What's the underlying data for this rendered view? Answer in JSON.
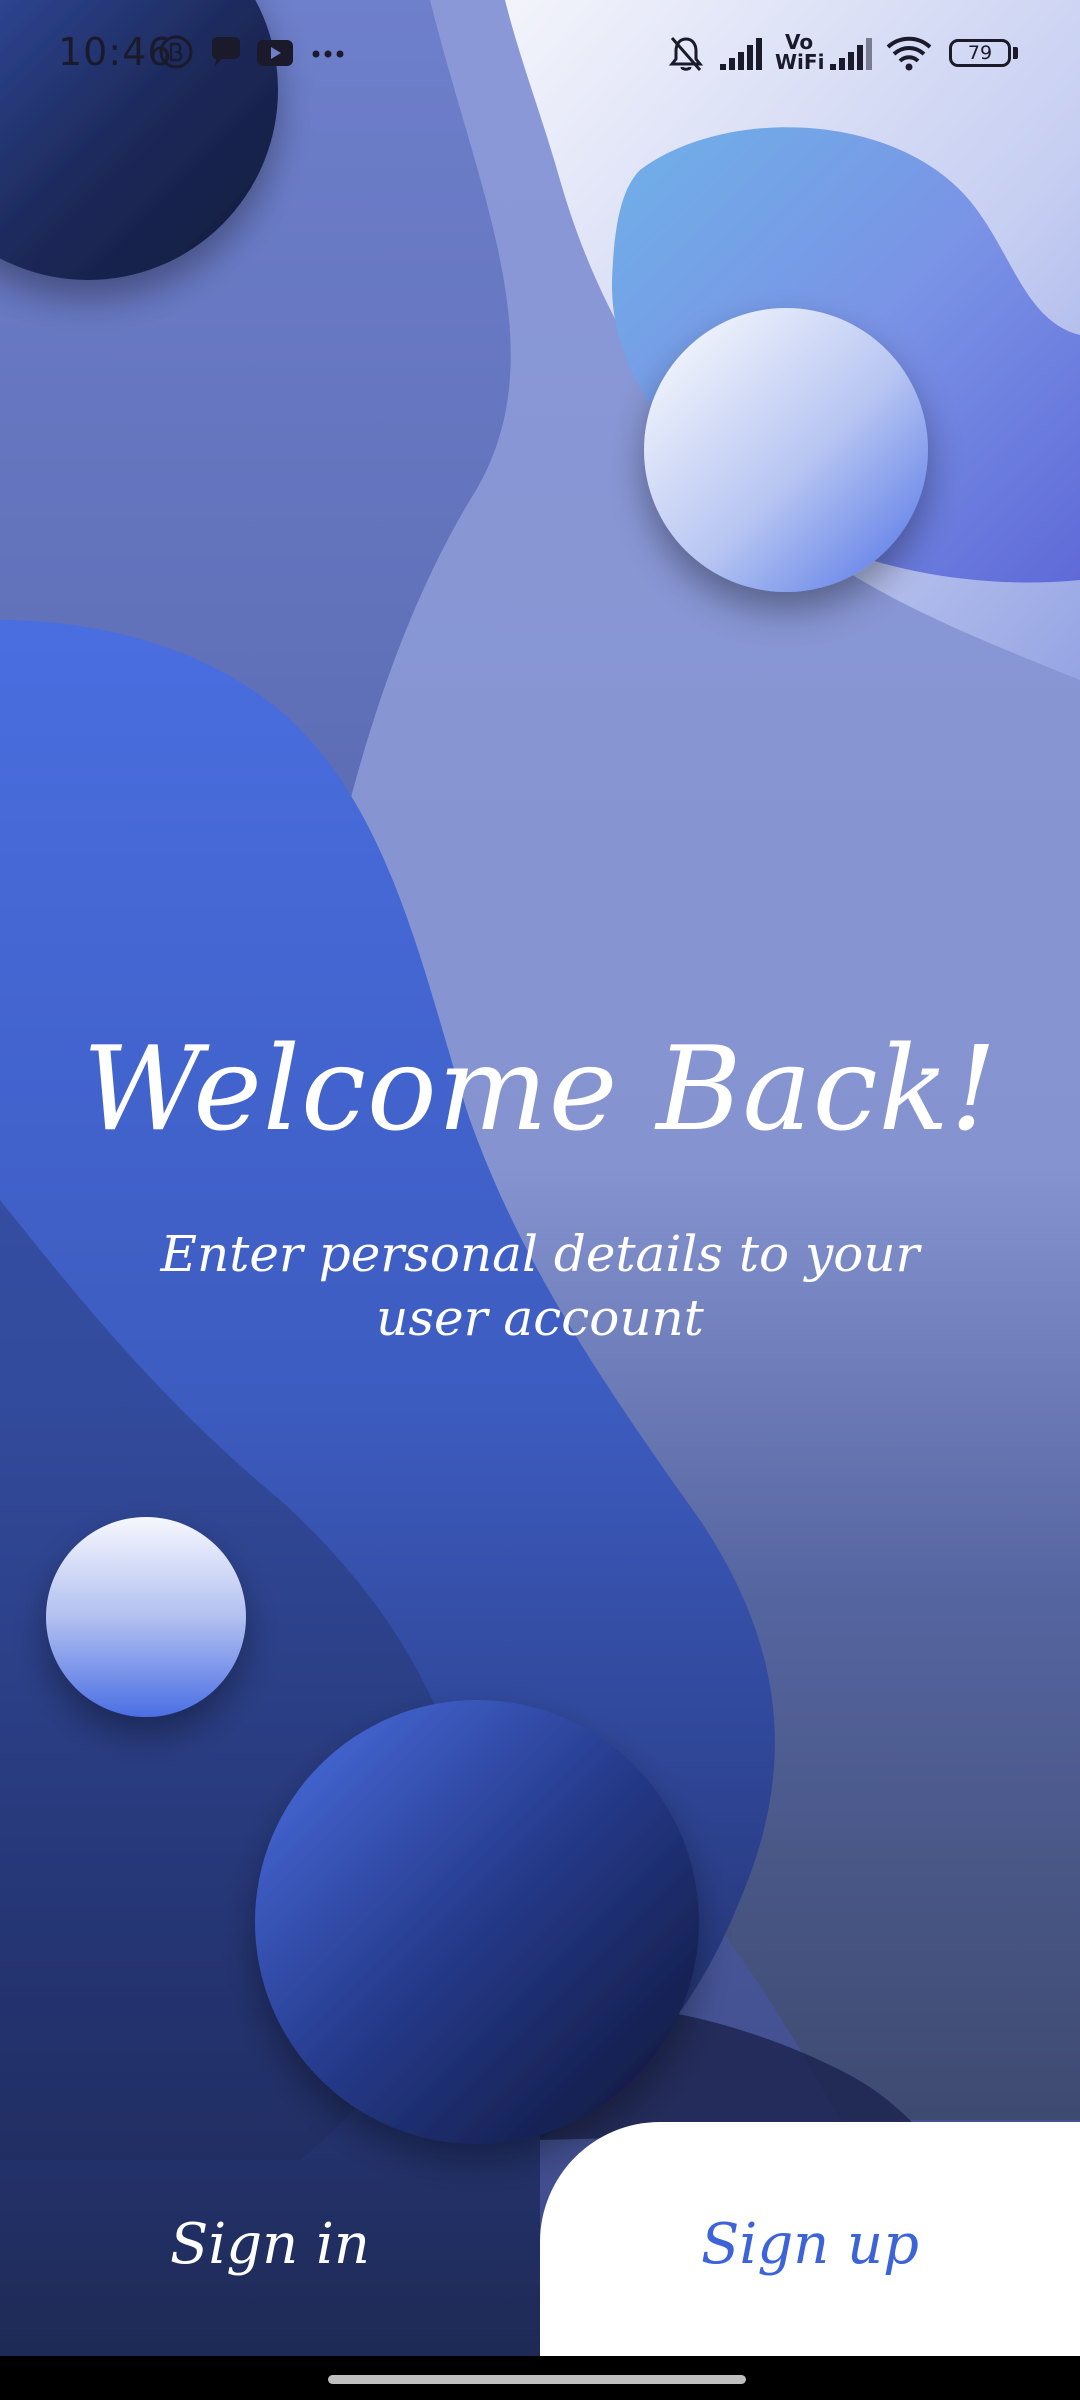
{
  "status_bar": {
    "time": "10:46",
    "vowifi_top": "Vo",
    "vowifi_bottom": "WiFi",
    "battery": "79",
    "icons": [
      "b-circle-icon",
      "chat-bubble-icon",
      "youtube-icon",
      "more-dots-icon",
      "bell-off-icon",
      "signal-icon",
      "wifi-icon",
      "battery-icon"
    ]
  },
  "welcome": {
    "title": "Welcome Back!",
    "subtitle": "Enter personal details to your user account"
  },
  "actions": {
    "sign_in": "Sign in",
    "sign_up": "Sign up"
  },
  "colors": {
    "accent": "#3c64d8",
    "background_mid": "#7c8ed0",
    "background_dark": "#1f2a55",
    "panel": "#ffffff"
  }
}
